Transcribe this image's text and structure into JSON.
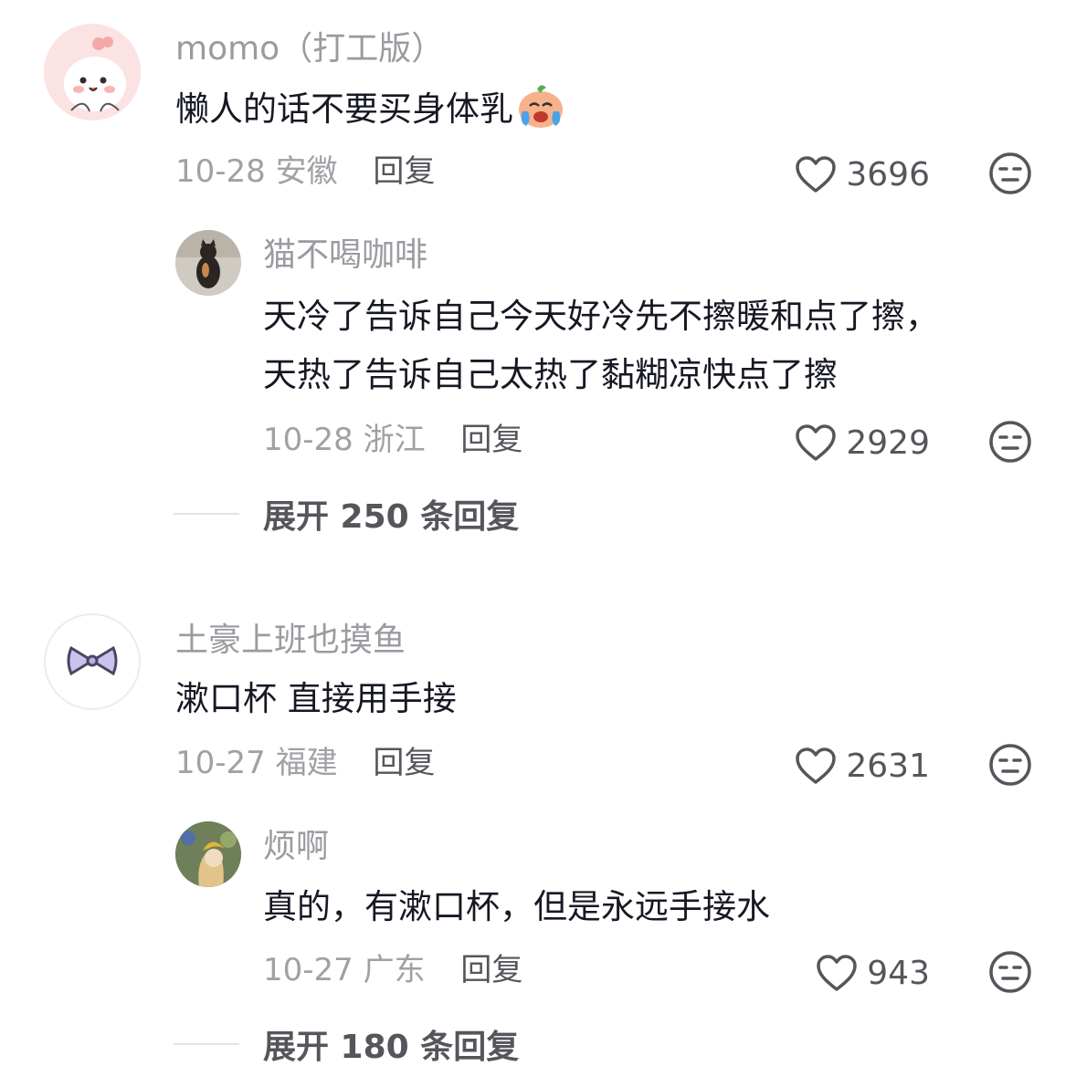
{
  "comments": [
    {
      "username": "momo（打工版）",
      "text": "懒人的话不要买身体乳",
      "emoji": "crying-face-emoji",
      "date": "10-28",
      "location": "安徽",
      "reply_label": "回复",
      "likes": "3696",
      "reply": {
        "username": "猫不喝咖啡",
        "text_lines": [
          "天冷了告诉自己今天好冷先不擦暖和点了擦，",
          "天热了告诉自己太热了黏糊凉快点了擦"
        ],
        "date": "10-28",
        "location": "浙江",
        "reply_label": "回复",
        "likes": "2929"
      },
      "expand_label": "展开 250 条回复"
    },
    {
      "username": "土豪上班也摸鱼",
      "text": "漱口杯 直接用手接",
      "date": "10-27",
      "location": "福建",
      "reply_label": "回复",
      "likes": "2631",
      "reply": {
        "username": "烦啊",
        "text_lines": [
          "真的，有漱口杯，但是永远手接水"
        ],
        "date": "10-27",
        "location": "广东",
        "reply_label": "回复",
        "likes": "943"
      },
      "expand_label": "展开 180 条回复"
    }
  ],
  "colors": {
    "primary_text": "#161823",
    "secondary_text": "#9a9ba0",
    "action_text": "#55565b"
  }
}
